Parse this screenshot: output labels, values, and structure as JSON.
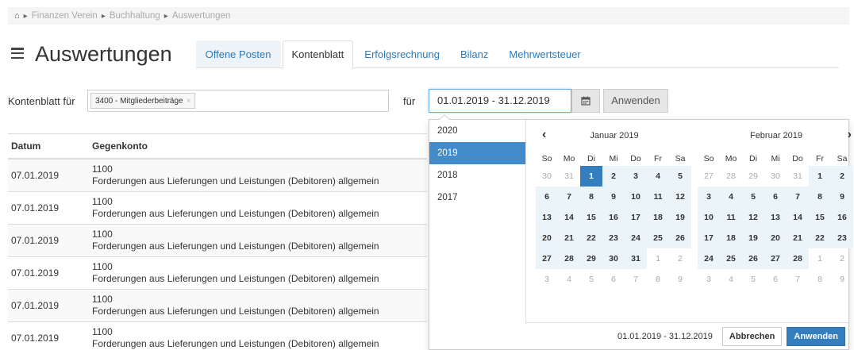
{
  "breadcrumb": {
    "items": [
      "Finanzen Verein",
      "Buchhaltung",
      "Auswertungen"
    ]
  },
  "header": {
    "title": "Auswertungen"
  },
  "tabs": [
    {
      "label": "Offene Posten"
    },
    {
      "label": "Kontenblatt"
    },
    {
      "label": "Erfolgsrechnung"
    },
    {
      "label": "Bilanz"
    },
    {
      "label": "Mehrwertsteuer"
    }
  ],
  "filter": {
    "label": "Kontenblatt für",
    "tag": "3400 - Mitgliederbeiträge",
    "fuer_label": "für",
    "date_value": "01.01.2019 - 31.12.2019",
    "apply_label": "Anwenden"
  },
  "table": {
    "headers": [
      "Datum",
      "Gegenkonto"
    ],
    "rows": [
      {
        "date": "07.01.2019",
        "account": "1100",
        "desc": "Forderungen aus Lieferungen und Leistungen (Debitoren) allgemein"
      },
      {
        "date": "07.01.2019",
        "account": "1100",
        "desc": "Forderungen aus Lieferungen und Leistungen (Debitoren) allgemein"
      },
      {
        "date": "07.01.2019",
        "account": "1100",
        "desc": "Forderungen aus Lieferungen und Leistungen (Debitoren) allgemein"
      },
      {
        "date": "07.01.2019",
        "account": "1100",
        "desc": "Forderungen aus Lieferungen und Leistungen (Debitoren) allgemein"
      },
      {
        "date": "07.01.2019",
        "account": "1100",
        "desc": "Forderungen aus Lieferungen und Leistungen (Debitoren) allgemein"
      },
      {
        "date": "07.01.2019",
        "account": "1100",
        "desc": "Forderungen aus Lieferungen und Leistungen (Debitoren) allgemein"
      }
    ]
  },
  "picker": {
    "years": [
      "2020",
      "2019",
      "2018",
      "2017"
    ],
    "active_year": "2019",
    "weekdays": [
      "So",
      "Mo",
      "Di",
      "Mi",
      "Do",
      "Fr",
      "Sa"
    ],
    "months": [
      {
        "title": "Januar 2019",
        "weeks": [
          [
            "30",
            "31",
            "1",
            "2",
            "3",
            "4",
            "5"
          ],
          [
            "6",
            "7",
            "8",
            "9",
            "10",
            "11",
            "12"
          ],
          [
            "13",
            "14",
            "15",
            "16",
            "17",
            "18",
            "19"
          ],
          [
            "20",
            "21",
            "22",
            "23",
            "24",
            "25",
            "26"
          ],
          [
            "27",
            "28",
            "29",
            "30",
            "31",
            "1",
            "2"
          ],
          [
            "3",
            "4",
            "5",
            "6",
            "7",
            "8",
            "9"
          ]
        ],
        "first_in": [
          0,
          2
        ],
        "last_in": [
          4,
          4
        ]
      },
      {
        "title": "Februar 2019",
        "weeks": [
          [
            "27",
            "28",
            "29",
            "30",
            "31",
            "1",
            "2"
          ],
          [
            "3",
            "4",
            "5",
            "6",
            "7",
            "8",
            "9"
          ],
          [
            "10",
            "11",
            "12",
            "13",
            "14",
            "15",
            "16"
          ],
          [
            "17",
            "18",
            "19",
            "20",
            "21",
            "22",
            "23"
          ],
          [
            "24",
            "25",
            "26",
            "27",
            "28",
            "1",
            "2"
          ],
          [
            "3",
            "4",
            "5",
            "6",
            "7",
            "8",
            "9"
          ]
        ],
        "first_in": [
          0,
          5
        ],
        "last_in": [
          4,
          4
        ]
      }
    ],
    "footer_range": "01.01.2019 - 31.12.2019",
    "cancel_label": "Abbrechen",
    "apply_label": "Anwenden"
  },
  "colors": {
    "accent": "#357ebd",
    "link": "#2a7ab8",
    "range_bg": "#ebf4f8"
  }
}
